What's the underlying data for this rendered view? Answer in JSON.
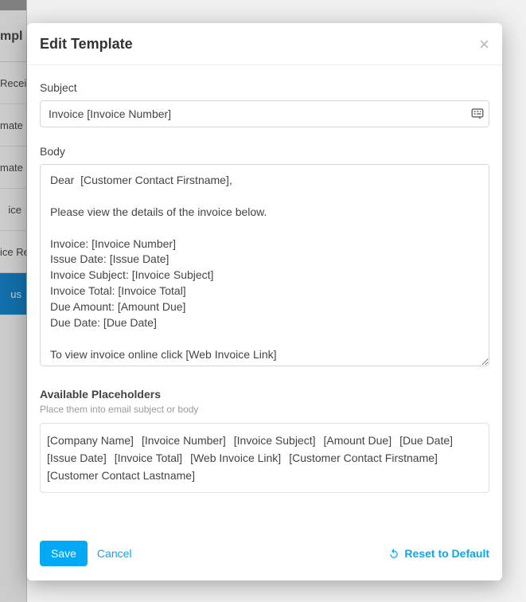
{
  "sidebar": {
    "heading": "mpl",
    "items": [
      {
        "label": "Receiv",
        "active": false
      },
      {
        "label": "mate",
        "active": false
      },
      {
        "label": "mate",
        "active": false
      },
      {
        "label": "ice",
        "active": false
      },
      {
        "label": "ice Re",
        "active": false
      },
      {
        "label": "us",
        "active": true
      }
    ]
  },
  "modal": {
    "title": "Edit Template",
    "close_glyph": "×",
    "subject": {
      "label": "Subject",
      "value": "Invoice [Invoice Number]"
    },
    "body": {
      "label": "Body",
      "value": "Dear  [Customer Contact Firstname],\n\nPlease view the details of the invoice below.\n\nInvoice: [Invoice Number]\nIssue Date: [Issue Date]\nInvoice Subject: [Invoice Subject]\nInvoice Total: [Invoice Total]\nDue Amount: [Amount Due]\nDue Date: [Due Date]\n\nTo view invoice online click [Web Invoice Link]"
    },
    "placeholders": {
      "title": "Available Placeholders",
      "hint": "Place them into email subject or body",
      "items": [
        "[Company Name]",
        "[Invoice Number]",
        "[Invoice Subject]",
        "[Amount Due]",
        "[Due Date]",
        "[Issue Date]",
        "[Invoice Total]",
        "[Web Invoice Link]",
        "[Customer Contact Firstname]",
        "[Customer Contact Lastname]"
      ]
    },
    "actions": {
      "save": "Save",
      "cancel": "Cancel",
      "reset": "Reset to Default"
    }
  }
}
